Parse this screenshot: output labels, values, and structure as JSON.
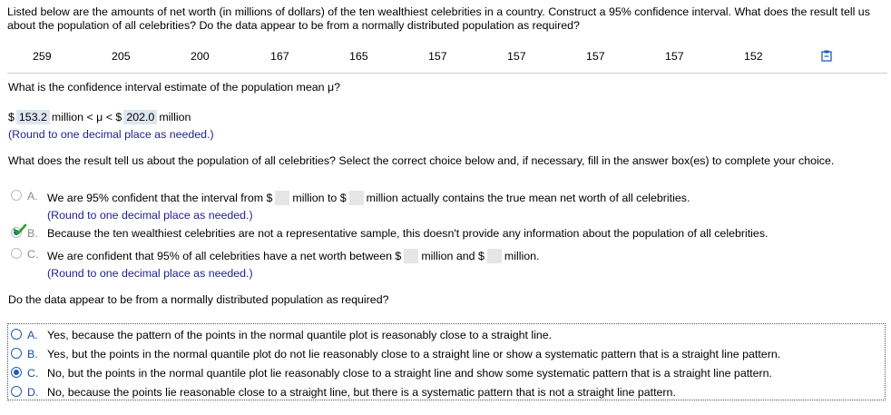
{
  "intro_text": "Listed below are the amounts of net worth (in millions of dollars) of the ten wealthiest celebrities in a country. Construct a 95% confidence interval. What does the result tell us about the population of all celebrities? Do the data appear to be from a normally distributed population as required?",
  "data_values": [
    "259",
    "205",
    "200",
    "167",
    "165",
    "157",
    "157",
    "157",
    "157",
    "152"
  ],
  "q1": {
    "question": "What is the confidence interval estimate of the population mean μ?",
    "dollar1": "$",
    "lower": "153.2",
    "mid": "million < μ < $",
    "upper": "202.0",
    "end": "million",
    "hint": "(Round to one decimal place as needed.)"
  },
  "q2": {
    "question": "What does the result tell us about the population of all celebrities? Select the correct choice below and, if necessary, fill in the answer box(es) to complete your choice.",
    "a_letter": "A.",
    "a_text1": "We are 95% confident that the interval from $",
    "a_text2": "million to $",
    "a_text3": "million actually contains the true mean net worth of all celebrities.",
    "a_hint": "(Round to one decimal place as needed.)",
    "b_letter": "B.",
    "b_text": "Because the ten wealthiest celebrities are not a representative sample, this doesn't provide any information about the population of all celebrities.",
    "c_letter": "C.",
    "c_text1": "We are confident that 95% of all celebrities have a net worth between $",
    "c_text2": "million and $",
    "c_text3": "million.",
    "c_hint": "(Round to one decimal place as needed.)",
    "selected": "B",
    "check_color": "#2e9e2e"
  },
  "q3": {
    "question": "Do the data appear to be from a normally distributed population as required?",
    "options": [
      {
        "letter": "A.",
        "text": "Yes, because the pattern of the points in the normal quantile plot is reasonably close to a straight line."
      },
      {
        "letter": "B.",
        "text": "Yes, but the points in the normal quantile plot do not lie reasonably close to a straight line or show a systematic pattern that is a straight line pattern."
      },
      {
        "letter": "C.",
        "text": "No, but the points in the normal quantile plot lie reasonably close to a straight line and show some systematic pattern that is a straight line pattern."
      },
      {
        "letter": "D.",
        "text": "No, because the points lie reasonable close to a straight line, but there is a systematic pattern that is not a straight line pattern."
      }
    ],
    "selected": "C"
  },
  "colors": {
    "accent": "#1d5fb4",
    "hint": "#1f1f8f",
    "answer_box": "#dde6f0"
  },
  "icons": {
    "clipboard": "clipboard-icon",
    "check": "checkmark-icon"
  }
}
